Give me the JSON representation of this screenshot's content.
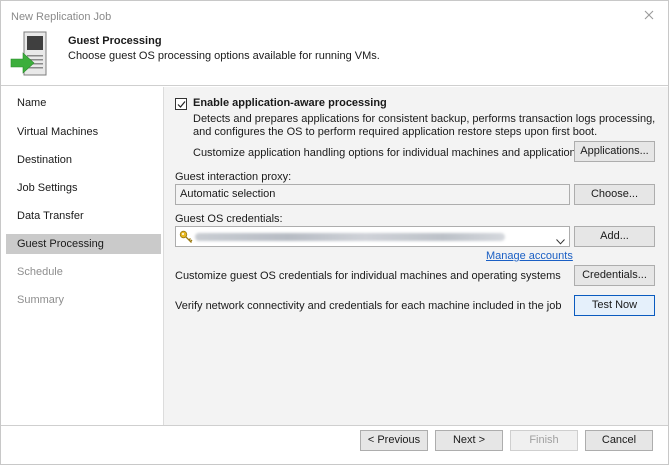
{
  "window": {
    "title": "New Replication Job"
  },
  "header": {
    "title": "Guest Processing",
    "subtitle": "Choose guest OS processing options available for running VMs."
  },
  "sidebar": {
    "items": [
      {
        "label": "Name"
      },
      {
        "label": "Virtual Machines"
      },
      {
        "label": "Destination"
      },
      {
        "label": "Job Settings"
      },
      {
        "label": "Data Transfer"
      },
      {
        "label": "Guest Processing"
      },
      {
        "label": "Schedule"
      },
      {
        "label": "Summary"
      }
    ],
    "active": "Guest Processing"
  },
  "main": {
    "app_aware": {
      "label": "Enable application-aware processing",
      "checked": true,
      "description": "Detects and prepares applications for consistent backup, performs transaction logs processing, and configures the OS to perform required application restore steps upon first boot."
    },
    "customize_apps_text": "Customize application handling options for individual machines and applications",
    "applications_button": "Applications...",
    "proxy_label": "Guest interaction proxy:",
    "proxy_value": "Automatic selection",
    "choose_button": "Choose...",
    "credentials_label": "Guest OS credentials:",
    "add_button": "Add...",
    "manage_accounts_link": "Manage accounts",
    "customize_creds_text": "Customize guest OS credentials for individual machines and operating systems",
    "credentials_button": "Credentials...",
    "verify_text": "Verify network connectivity and credentials for each machine included in the job",
    "test_now_button": "Test Now"
  },
  "footer": {
    "previous": "< Previous",
    "next": "Next >",
    "finish": "Finish",
    "cancel": "Cancel"
  },
  "colors": {
    "accent": "#0a5bbf",
    "active_nav": "#cacaca",
    "link": "#1a5fc4",
    "icon_green": "#3cae3c"
  },
  "icons": [
    "server-with-green-arrow-icon",
    "close-icon",
    "checkmark-icon",
    "key-icon",
    "chevron-down-icon"
  ]
}
